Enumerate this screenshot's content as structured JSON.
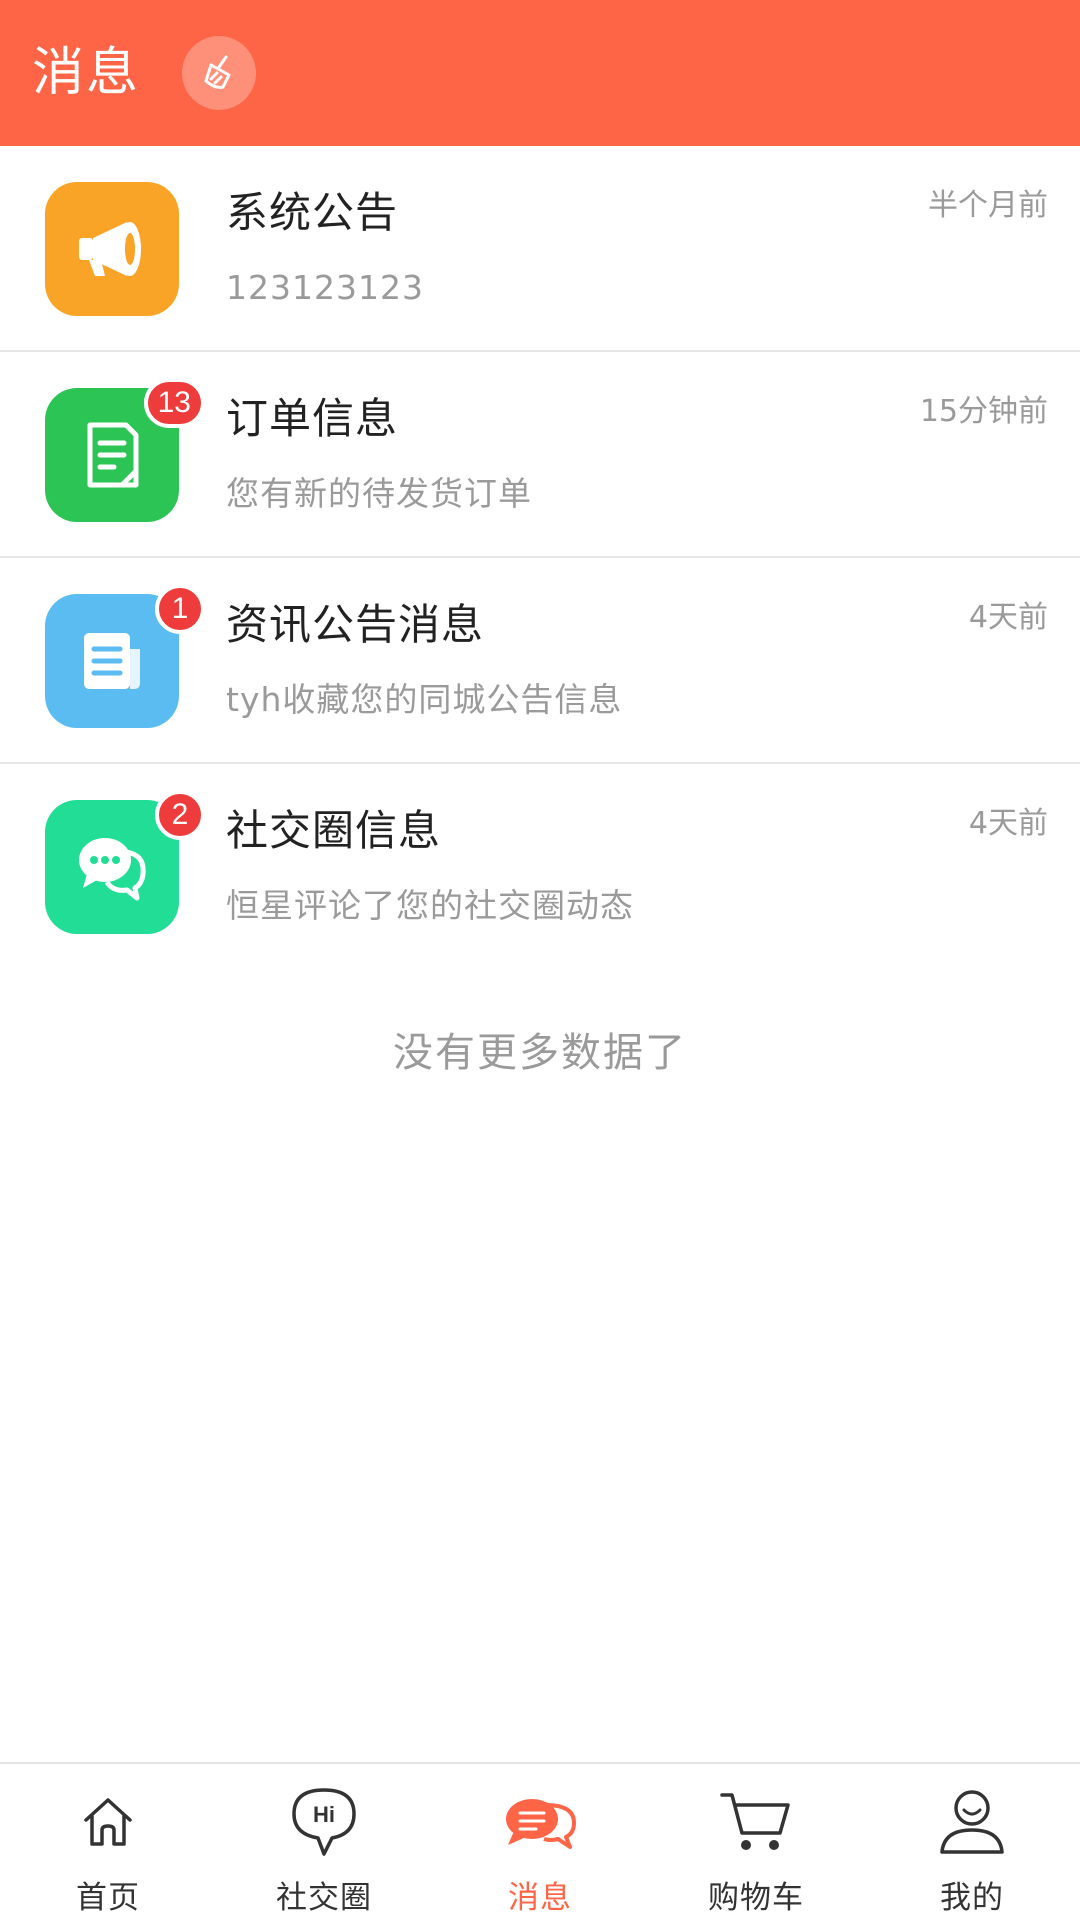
{
  "header": {
    "title": "消息"
  },
  "messages": [
    {
      "title": "系统公告",
      "subtitle": "123123123",
      "time": "半个月前",
      "badge": "",
      "icon": "megaphone-icon",
      "color": "#f9a327"
    },
    {
      "title": "订单信息",
      "subtitle": "您有新的待发货订单",
      "time": "15分钟前",
      "badge": "13",
      "icon": "order-document-icon",
      "color": "#2dc456"
    },
    {
      "title": "资讯公告消息",
      "subtitle": "tyh收藏您的同城公告信息",
      "time": "4天前",
      "badge": "1",
      "icon": "news-icon",
      "color": "#5bbcf2"
    },
    {
      "title": "社交圈信息",
      "subtitle": "恒星评论了您的社交圈动态",
      "time": "4天前",
      "badge": "2",
      "icon": "chat-bubbles-icon",
      "color": "#22dd96"
    }
  ],
  "footer": {
    "no_more": "没有更多数据了"
  },
  "tabbar": {
    "tabs": [
      {
        "label": "首页",
        "icon": "home-icon",
        "active": false
      },
      {
        "label": "社交圈",
        "icon": "hi-bubble-icon",
        "active": false
      },
      {
        "label": "消息",
        "icon": "message-bubbles-icon",
        "active": true
      },
      {
        "label": "购物车",
        "icon": "cart-icon",
        "active": false
      },
      {
        "label": "我的",
        "icon": "user-icon",
        "active": false
      }
    ]
  },
  "colors": {
    "accent": "#fe6446",
    "badge": "#ee3b3b"
  }
}
